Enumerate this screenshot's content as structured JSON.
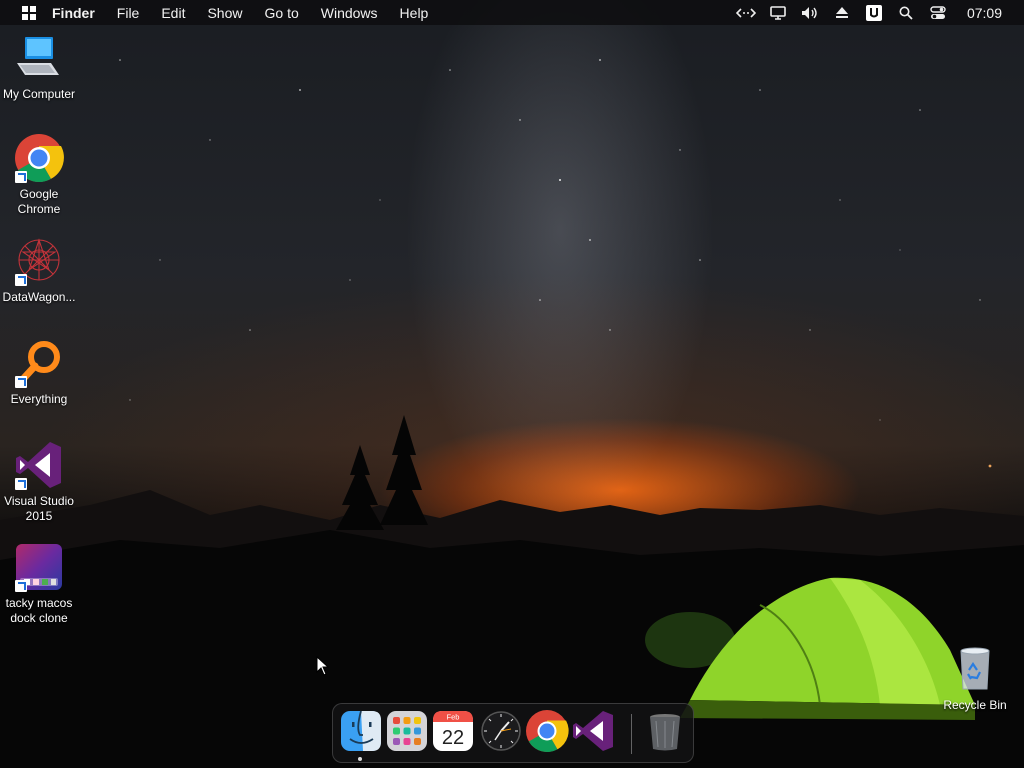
{
  "menubar": {
    "app_name": "Finder",
    "items": [
      "File",
      "Edit",
      "Show",
      "Go to",
      "Windows",
      "Help"
    ],
    "tray_icons": [
      "remote-arrows-icon",
      "display-icon",
      "speaker-icon",
      "eject-icon",
      "u-app-icon",
      "search-icon",
      "control-center-icon"
    ],
    "clock": "07:09"
  },
  "desktop": {
    "icons": [
      {
        "label": "My Computer",
        "icon": "computer-icon"
      },
      {
        "label": "Google Chrome",
        "icon": "chrome-icon"
      },
      {
        "label": "DataWagon...",
        "icon": "datawagon-icon"
      },
      {
        "label": "Everything",
        "icon": "everything-search-icon"
      },
      {
        "label": "Visual Studio 2015",
        "icon": "visual-studio-icon"
      },
      {
        "label": "tacky macos dock clone",
        "icon": "dock-clone-icon"
      }
    ],
    "recycle_bin": {
      "label": "Recycle Bin",
      "icon": "recycle-bin-icon"
    }
  },
  "dock": {
    "items": [
      "finder-icon",
      "launchpad-icon",
      "calendar-icon",
      "clock-icon",
      "chrome-icon",
      "visual-studio-icon",
      "trash-icon"
    ],
    "calendar_month": "Feb",
    "calendar_day": "22"
  },
  "colors": {
    "menubar_bg": "#0e0e10",
    "tent_green": "#8fd42a",
    "horizon_orange": "#ff6e14",
    "vs_purple": "#68217a"
  }
}
